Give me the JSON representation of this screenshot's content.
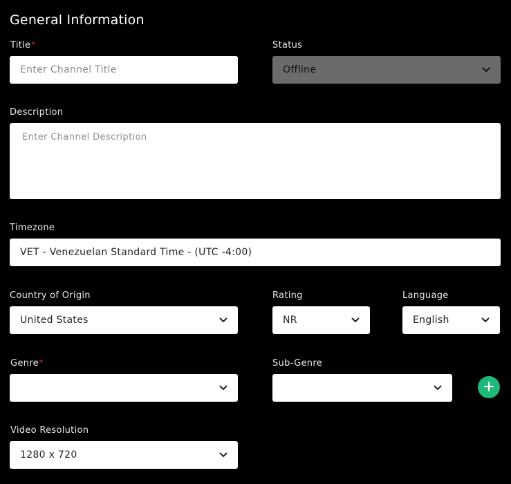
{
  "section": {
    "title": "General Information"
  },
  "title_field": {
    "label": "Title",
    "required_mark": "*",
    "placeholder": "Enter Channel Title"
  },
  "status_field": {
    "label": "Status",
    "value": "Offline"
  },
  "description_field": {
    "label": "Description",
    "placeholder": "Enter Channel Description"
  },
  "timezone_field": {
    "label": "Timezone",
    "value": "VET - Venezuelan Standard Time - (UTC -4:00)"
  },
  "country_field": {
    "label": "Country of Origin",
    "value": "United States"
  },
  "rating_field": {
    "label": "Rating",
    "value": "NR"
  },
  "language_field": {
    "label": "Language",
    "value": "English"
  },
  "genre_field": {
    "label": "Genre",
    "required_mark": "*",
    "value": ""
  },
  "subgenre_field": {
    "label": "Sub-Genre",
    "value": ""
  },
  "add_button": {
    "icon": "plus-icon",
    "color": "#1db97a"
  },
  "resolution_field": {
    "label": "Video Resolution",
    "value": "1280 x 720"
  },
  "colors": {
    "background": "#000000",
    "required": "#e53935",
    "disabled_field": "#6b6b6b"
  }
}
